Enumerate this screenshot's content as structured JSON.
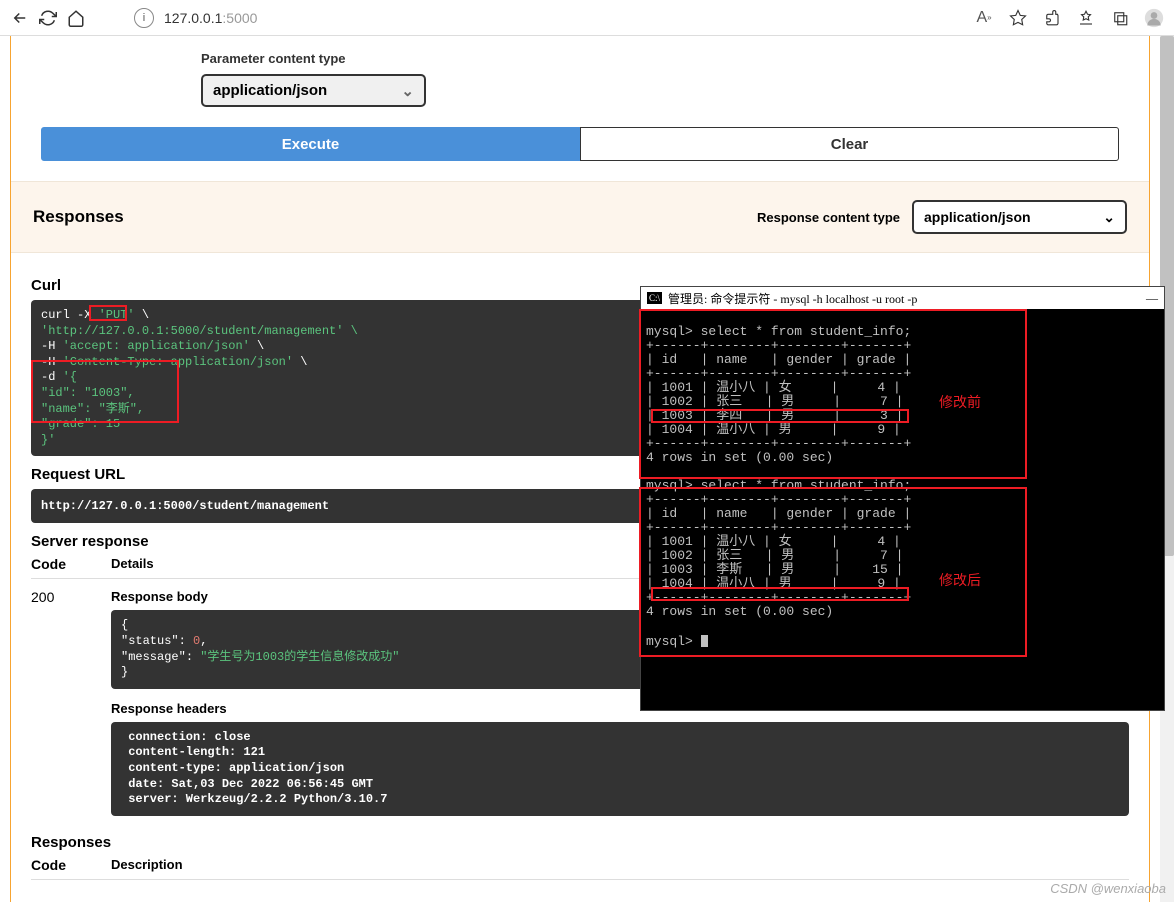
{
  "browser": {
    "url_host": "127.0.0.1",
    "url_port": ":5000",
    "ai_badge": "A"
  },
  "swagger": {
    "param_type_label": "Parameter content type",
    "param_type_value": "application/json",
    "execute_label": "Execute",
    "clear_label": "Clear",
    "responses_heading": "Responses",
    "resp_content_type_label": "Response content type",
    "resp_content_type_value": "application/json",
    "curl_heading": "Curl",
    "curl": {
      "l1a": "curl -X ",
      "l1b": "'PUT'",
      "l1c": " \\",
      "l2": "  'http://127.0.0.1:5000/student/management' \\",
      "l3a": "  -H ",
      "l3b": "'accept: application/json'",
      "l3c": " \\",
      "l4a": "  -H ",
      "l4b": "'Content-Type: application/json'",
      "l4c": " \\",
      "l5a": "  -d ",
      "l5b": "'{",
      "l6": "  \"id\": \"1003\",",
      "l7": "  \"name\": \"李斯\",",
      "l8": "  \"grade\": 15",
      "l9": "}'"
    },
    "request_url_heading": "Request URL",
    "request_url": "http://127.0.0.1:5000/student/management",
    "server_response_heading": "Server response",
    "code_heading": "Code",
    "details_heading": "Details",
    "code_value": "200",
    "response_body_heading": "Response body",
    "response_body": {
      "open": "{",
      "l1a": "  \"status\"",
      "l1b": ": ",
      "l1c": "0",
      "l1d": ",",
      "l2a": "  \"message\"",
      "l2b": ": ",
      "l2c": "\"学生号为1003的学生信息修改成功\"",
      "close": "}"
    },
    "response_headers_heading": "Response headers",
    "response_headers": " connection: close \n content-length: 121 \n content-type: application/json \n date: Sat,03 Dec 2022 06:56:45 GMT \n server: Werkzeug/2.2.2 Python/3.10.7 ",
    "responses_heading2": "Responses",
    "description_heading": "Description"
  },
  "terminal": {
    "title": "管理员: 命令提示符 - mysql  -h localhost -u root -p",
    "minimize": "—",
    "before_label": "修改前",
    "after_label": "修改后",
    "query": "mysql> select * from student_info;",
    "sep": "+------+--------+--------+-------+",
    "header_row": "| id   | name   | gender | grade |",
    "rows_before": [
      "| 1001 | 温小八 | 女     |     4 |",
      "| 1002 | 张三   | 男     |     7 |",
      "| 1003 | 李四   | 男     |     3 |",
      "| 1004 | 温小八 | 男     |     9 |"
    ],
    "rows_after": [
      "| 1001 | 温小八 | 女     |     4 |",
      "| 1002 | 张三   | 男     |     7 |",
      "| 1003 | 李斯   | 男     |    15 |",
      "| 1004 | 温小八 | 男     |     9 |"
    ],
    "result_text": "4 rows in set (0.00 sec)",
    "prompt": "mysql> "
  },
  "watermark": "CSDN @wenxiaoba"
}
